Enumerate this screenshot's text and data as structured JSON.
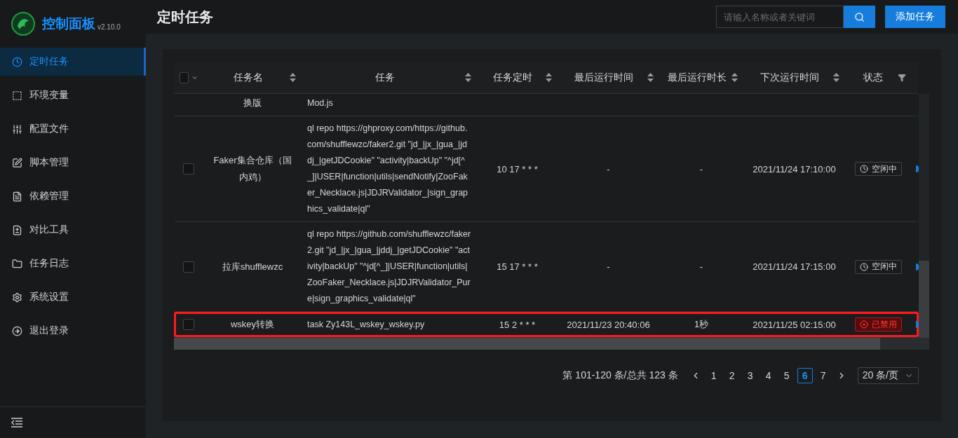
{
  "sidebar": {
    "logo_title": "控制面板",
    "version": "v2.10.0",
    "items": [
      {
        "label": "定时任务",
        "selected": true
      },
      {
        "label": "环境变量",
        "selected": false
      },
      {
        "label": "配置文件",
        "selected": false
      },
      {
        "label": "脚本管理",
        "selected": false
      },
      {
        "label": "依赖管理",
        "selected": false
      },
      {
        "label": "对比工具",
        "selected": false
      },
      {
        "label": "任务日志",
        "selected": false
      },
      {
        "label": "系统设置",
        "selected": false
      },
      {
        "label": "退出登录",
        "selected": false
      }
    ]
  },
  "header": {
    "title": "定时任务",
    "search": {
      "placeholder": "请输入名称或者关键词"
    },
    "add_button": "添加任务"
  },
  "table": {
    "select_all": {
      "checked": false
    },
    "columns": [
      {
        "label": "任务名",
        "kind": "sort"
      },
      {
        "label": "任务",
        "kind": "sort"
      },
      {
        "label": "任务定时",
        "kind": "sort"
      },
      {
        "label": "最后运行时间",
        "kind": "sort"
      },
      {
        "label": "最后运行时长",
        "kind": "sort"
      },
      {
        "label": "下次运行时间",
        "kind": "sort"
      },
      {
        "label": "状态",
        "kind": "filter"
      }
    ],
    "rows": [
      {
        "kind": "partial",
        "name": "换版",
        "command": "Mod.js"
      },
      {
        "kind": "full",
        "checked": false,
        "name": "Faker集合仓库（国内鸡）",
        "command": "ql repo https://ghproxy.com/https://github.com/shufflewzc/faker2.git \"jd_|jx_|gua_|jddj_|getJDCookie\" \"activity|backUp\" \"^jd[^_]|USER|function|utils|sendNotify|ZooFaker_Necklace.js|JDJRValidator_|sign_graphics_validate|ql\"",
        "schedule": "10 17 * * *",
        "last_run": "-",
        "duration": "-",
        "next_run": "2021/11/24 17:10:00",
        "status": {
          "kind": "idle",
          "label": "空闲中"
        },
        "highlighted": false
      },
      {
        "kind": "full",
        "checked": false,
        "name": "拉库shufflewzc",
        "command": "ql repo https://github.com/shufflewzc/faker2.git \"jd_|jx_|gua_|jddj_|getJDCookie\" \"activity|backUp\" \"^jd[^_]|USER|function|utils|ZooFaker_Necklace.js|JDJRValidator_Pure|sign_graphics_validate|ql\"",
        "schedule": "15 17 * * *",
        "last_run": "-",
        "duration": "-",
        "next_run": "2021/11/24 17:15:00",
        "status": {
          "kind": "idle",
          "label": "空闲中"
        },
        "highlighted": false
      },
      {
        "kind": "full",
        "checked": false,
        "name": "wskey转换",
        "command": "task Zy143L_wskey_wskey.py",
        "schedule": "15 2 * * *",
        "last_run": "2021/11/23 20:40:06",
        "duration": "1秒",
        "next_run": "2021/11/25 02:15:00",
        "status": {
          "kind": "disabled",
          "label": "已禁用"
        },
        "highlighted": true
      }
    ]
  },
  "pagination": {
    "summary": "第 101-120 条/总共 123 条",
    "pages": [
      {
        "label": "1",
        "selected": false
      },
      {
        "label": "2",
        "selected": false
      },
      {
        "label": "3",
        "selected": false
      },
      {
        "label": "4",
        "selected": false
      },
      {
        "label": "5",
        "selected": false
      },
      {
        "label": "6",
        "selected": true
      },
      {
        "label": "7",
        "selected": false
      }
    ],
    "page_size": "20 条/页"
  }
}
